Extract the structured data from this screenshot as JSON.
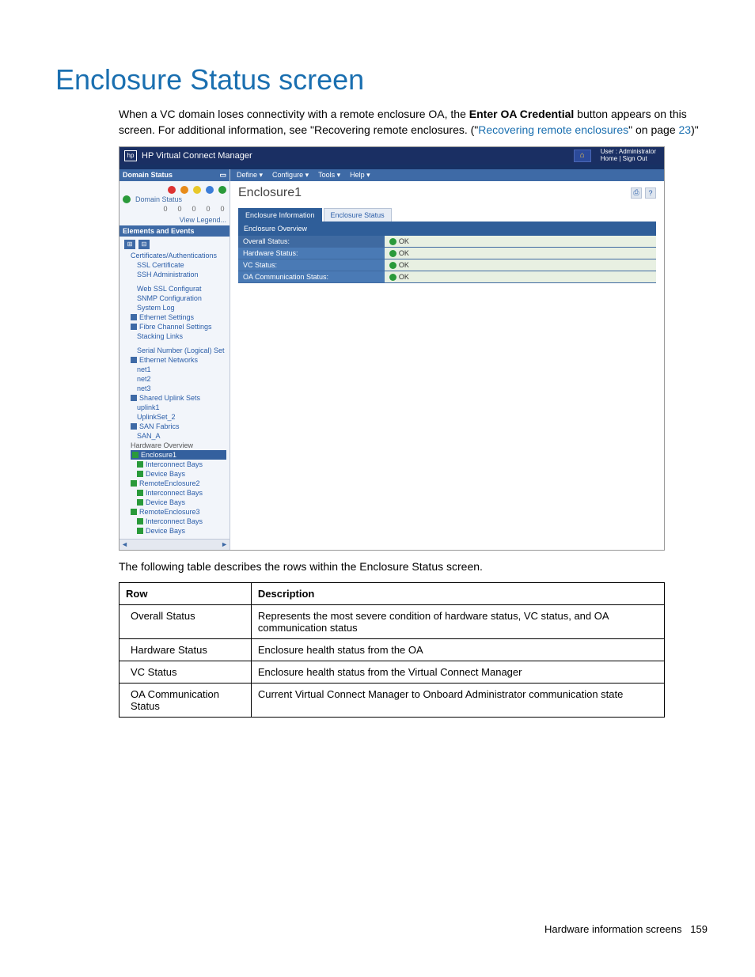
{
  "page": {
    "title": "Enclosure Status screen",
    "intro_before_bold": "When a VC domain loses connectivity with a remote enclosure OA, the ",
    "bold_label": "Enter OA Credential",
    "intro_after_bold": " button appears on this screen. For additional information, see \"Recovering remote enclosures. (\"",
    "link_text": "Recovering remote enclosures",
    "intro_tail1": "\" on page ",
    "page_ref": "23",
    "intro_tail2": ")\"",
    "table_intro": "The following table describes the rows within the Enclosure Status screen.",
    "footer_text": "Hardware information screens",
    "footer_page": "159"
  },
  "vc": {
    "product": "HP Virtual Connect Manager",
    "user_label": "User : Administrator",
    "home_signout": "Home | Sign Out",
    "menus": [
      "Define ▾",
      "Configure ▾",
      "Tools ▾",
      "Help ▾"
    ],
    "domain_status_title": "Domain Status",
    "domain_label": "Domain Status",
    "view_legend": "View Legend...",
    "elements_title": "Elements and Events",
    "tree": {
      "group1": "Certificates/Authentications",
      "items1": [
        "SSL Certificate",
        "SSH Administration"
      ],
      "items2": [
        "Web SSL Configurat",
        "SNMP Configuration",
        "System Log"
      ],
      "eth_settings": "Ethernet Settings",
      "fc_settings": "Fibre Channel Settings",
      "stacking": "Stacking Links",
      "serial": "Serial Number (Logical) Set",
      "eth_net": "Ethernet Networks",
      "nets": [
        "net1",
        "net2",
        "net3"
      ],
      "shared": "Shared Uplink Sets",
      "uplinks": [
        "uplink1",
        "UplinkSet_2"
      ],
      "san": "SAN Fabrics",
      "san_items": [
        "SAN_A"
      ],
      "hw_over": "Hardware Overview",
      "enc1": "Enclosure1",
      "enc1_items": [
        "Interconnect Bays",
        "Device Bays"
      ],
      "enc2": "RemoteEnclosure2",
      "enc2_items": [
        "Interconnect Bays",
        "Device Bays"
      ],
      "enc3": "RemoteEnclosure3",
      "enc3_items": [
        "Interconnect Bays",
        "Device Bays"
      ]
    },
    "main": {
      "title": "Enclosure1",
      "tab1": "Enclosure Information",
      "tab2": "Enclosure Status",
      "ov_title": "Enclosure Overview",
      "rows": [
        {
          "label": "Overall Status:",
          "val": "OK"
        },
        {
          "label": "Hardware Status:",
          "val": "OK"
        },
        {
          "label": "VC Status:",
          "val": "OK"
        },
        {
          "label": "OA Communication Status:",
          "val": "OK"
        }
      ]
    }
  },
  "table": {
    "headers": [
      "Row",
      "Description"
    ],
    "rows": [
      [
        "Overall Status",
        "Represents the most severe condition of hardware status, VC status, and OA communication status"
      ],
      [
        "Hardware Status",
        "Enclosure health status from the OA"
      ],
      [
        "VC Status",
        "Enclosure health status from the Virtual Connect Manager"
      ],
      [
        "OA Communication Status",
        "Current Virtual Connect Manager to Onboard Administrator communication state"
      ]
    ]
  }
}
